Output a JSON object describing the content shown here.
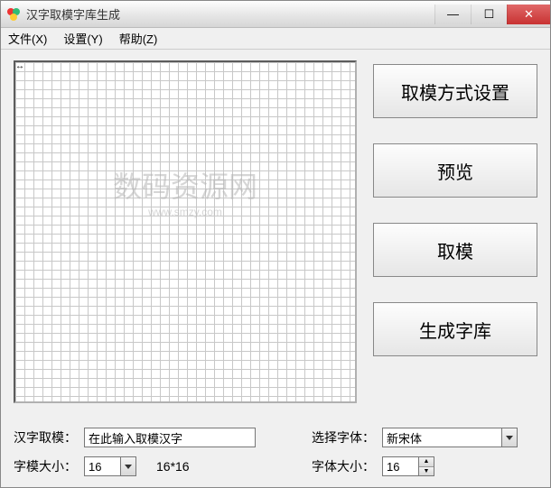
{
  "window": {
    "title": "汉字取模字库生成"
  },
  "menu": {
    "file": "文件(X)",
    "settings": "设置(Y)",
    "help": "帮助(Z)"
  },
  "watermark": {
    "main": "数码资源网",
    "sub": "www.smzy.com"
  },
  "buttons": {
    "mode_settings": "取模方式设置",
    "preview": "预览",
    "extract": "取模",
    "generate": "生成字库"
  },
  "bottom": {
    "hanzi_label": "汉字取模：",
    "hanzi_input": "在此输入取模汉字",
    "font_select_label": "选择字体：",
    "font_select_value": "新宋体",
    "glyph_size_label": "字模大小：",
    "glyph_size_value": "16",
    "glyph_size_display": "16*16",
    "font_size_label": "字体大小：",
    "font_size_value": "16"
  }
}
